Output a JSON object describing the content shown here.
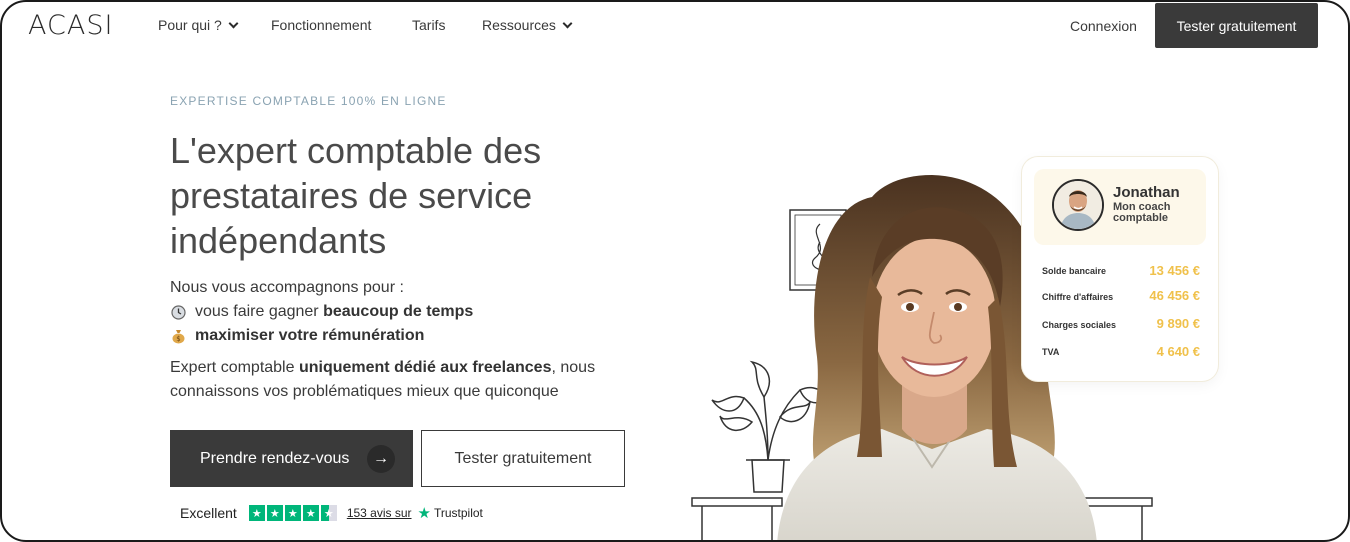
{
  "nav": {
    "logo": "ACASI",
    "items": [
      {
        "label": "Pour qui ?",
        "dropdown": true
      },
      {
        "label": "Fonctionnement",
        "dropdown": false
      },
      {
        "label": "Tarifs",
        "dropdown": false
      },
      {
        "label": "Ressources",
        "dropdown": true
      }
    ],
    "login": "Connexion",
    "cta": "Tester gratuitement"
  },
  "hero": {
    "eyebrow": "EXPERTISE COMPTABLE 100% EN LIGNE",
    "headline": "L'expert comptable des prestataires de service indépendants",
    "intro": "Nous vous accompagnons pour :",
    "bullets": [
      {
        "icon": "clock-icon",
        "text": "vous faire gagner ",
        "bold": "beaucoup de temps"
      },
      {
        "icon": "money-bag-icon",
        "text": "",
        "bold": "maximiser votre rémunération"
      }
    ],
    "body_prefix": "Expert comptable ",
    "body_bold": "uniquement dédié aux freelances",
    "body_suffix": ", nous connaissons vos problématiques mieux que quiconque",
    "primary_cta": "Prendre rendez-vous",
    "secondary_cta": "Tester gratuitement"
  },
  "trustpilot": {
    "rating_label": "Excellent",
    "stars": 4.5,
    "count": "153 avis sur",
    "brand": "Trustpilot"
  },
  "card": {
    "name": "Jonathan",
    "role": "Mon coach comptable",
    "rows": [
      {
        "label": "Solde bancaire",
        "value": "13 456 €"
      },
      {
        "label": "Chiffre d'affaires",
        "value": "46 456 €"
      },
      {
        "label": "Charges sociales",
        "value": "9 890 €"
      },
      {
        "label": "TVA",
        "value": "4 640 €"
      }
    ]
  },
  "colors": {
    "primary": "#3a3a3a",
    "eyebrow": "#8aa3b2",
    "accent_value": "#f0c14b",
    "trustpilot": "#00b67a"
  }
}
